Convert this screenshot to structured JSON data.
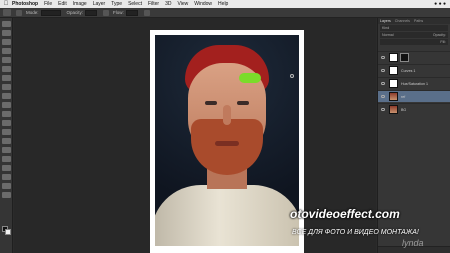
{
  "menubar": {
    "apple": "",
    "app": "Photoshop",
    "items": [
      "File",
      "Edit",
      "Image",
      "Layer",
      "Type",
      "Select",
      "Filter",
      "3D",
      "View",
      "Window",
      "Help"
    ]
  },
  "options": {
    "mode_label": "Mode:",
    "opacity_label": "Opacity:",
    "flow_label": "Flow:"
  },
  "panels": {
    "tabs": [
      "Layers",
      "Channels",
      "Paths"
    ],
    "kind_label": "Kind",
    "mode_value": "Normal",
    "opacity_label": "Opacity:",
    "fill_label": "Fill:",
    "layers": [
      {
        "name": "",
        "thumb": "white",
        "mask": true,
        "selected": false
      },
      {
        "name": "Curves 1",
        "thumb": "white",
        "mask": false,
        "selected": false
      },
      {
        "name": "Hue/Saturation 1",
        "thumb": "white",
        "mask": false,
        "selected": false
      },
      {
        "name": "ref",
        "thumb": "photo",
        "mask": false,
        "selected": true
      },
      {
        "name": "BG",
        "thumb": "photo",
        "mask": false,
        "selected": false
      }
    ]
  },
  "watermarks": {
    "site": "otovideoeffect.com",
    "slogan": "ВСЕ ДЛЯ ФОТО И ВИДЕО МОНТАЖА!",
    "brand": "lynda"
  },
  "colors": {
    "foreground": "#111111",
    "background": "#f2f2f2",
    "hair": "#a3201e",
    "mask_stroke": "#7bdc2a"
  }
}
